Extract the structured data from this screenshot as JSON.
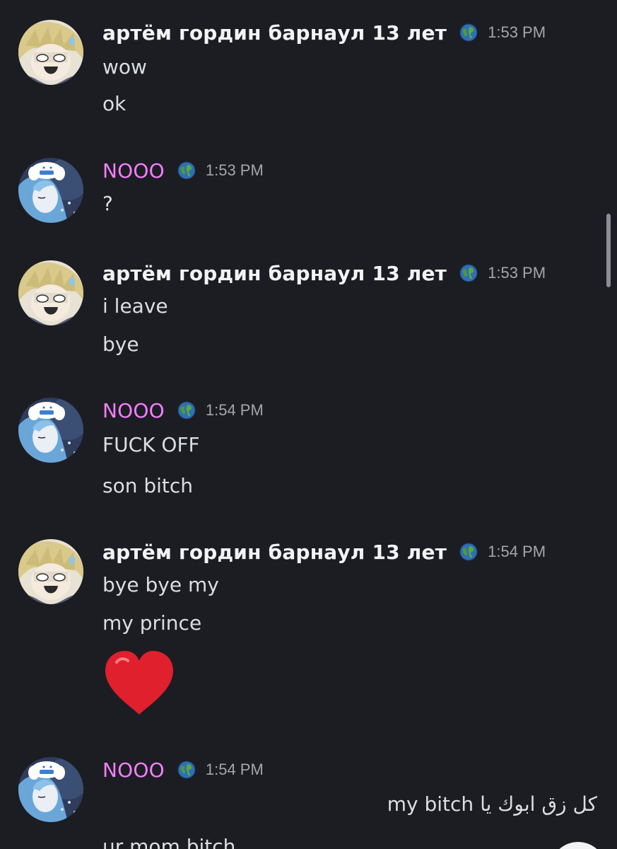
{
  "colors": {
    "background": "#1c1d22",
    "text": "#dbdee1",
    "username_default": "#f2f3f5",
    "username_pink": "#f47fff",
    "timestamp": "#a3a6aa"
  },
  "messages": [
    {
      "user": "артём гордин барнаул 13 лет",
      "badge_icon": "globe-icon",
      "time": "1:53 PM",
      "lines": [
        "wow",
        "ok"
      ]
    },
    {
      "user": "NOOO",
      "badge_icon": "globe-icon",
      "time": "1:53 PM",
      "lines": [
        "?"
      ]
    },
    {
      "user": "артём гордин барнаул 13 лет",
      "badge_icon": "globe-icon",
      "time": "1:53 PM",
      "lines": [
        "i leave",
        "bye"
      ]
    },
    {
      "user": "NOOO",
      "badge_icon": "globe-icon",
      "time": "1:54 PM",
      "lines": [
        "FUCK OFF",
        "son bitch"
      ]
    },
    {
      "user": "артём гордин барнаул 13 лет",
      "badge_icon": "globe-icon",
      "time": "1:54 PM",
      "lines": [
        "bye bye my",
        "my prince"
      ],
      "emoji": "heart-emoji"
    },
    {
      "user": "NOOO",
      "badge_icon": "globe-icon",
      "time": "1:54 PM",
      "lines": [
        "كل زق ابوك يا my bitch",
        "ur mom bitch"
      ]
    }
  ]
}
